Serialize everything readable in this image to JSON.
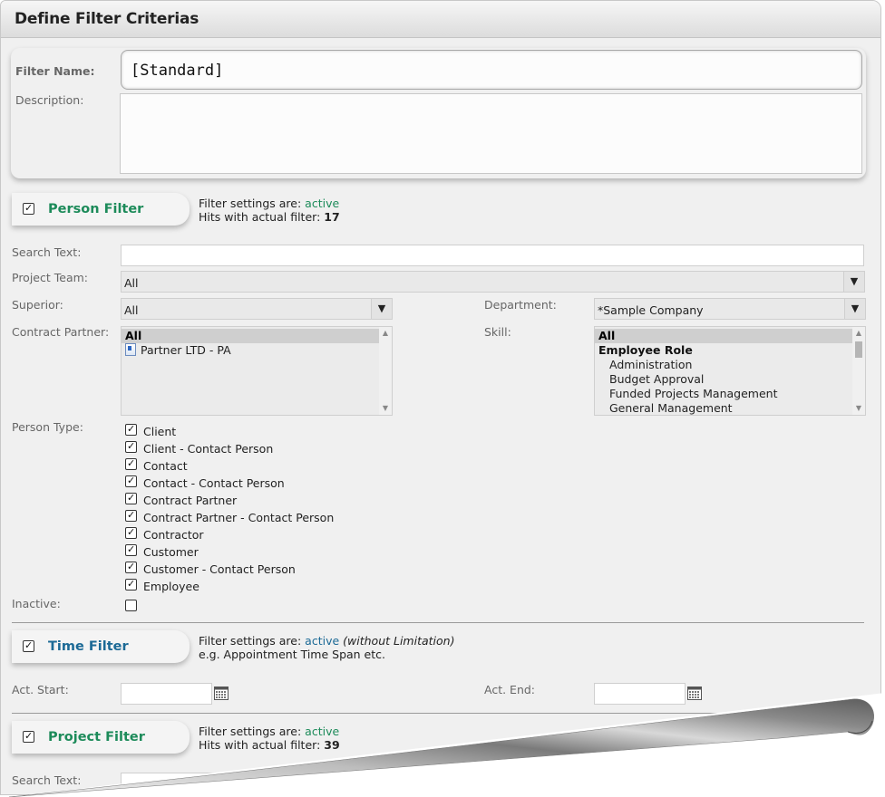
{
  "window": {
    "title": "Define Filter Criterias"
  },
  "filter": {
    "name_label": "Filter Name:",
    "name_value": "[Standard]",
    "description_label": "Description:",
    "description_value": ""
  },
  "person_filter": {
    "tab_label": "Person Filter",
    "checked": true,
    "status_prefix": "Filter settings are:",
    "status": "active",
    "hits_label": "Hits with actual filter:",
    "hits": "17",
    "search_label": "Search Text:",
    "search_value": "",
    "project_team_label": "Project Team:",
    "project_team_value": "All",
    "superior_label": "Superior:",
    "superior_value": "All",
    "department_label": "Department:",
    "department_value": "*Sample Company",
    "contract_partner_label": "Contract Partner:",
    "contract_partner_items": [
      "All",
      "Partner LTD - PA"
    ],
    "skill_label": "Skill:",
    "skill_items": [
      "All",
      "Employee Role",
      "Administration",
      "Budget Approval",
      "Funded Projects Management",
      "General Management"
    ],
    "person_type_label": "Person Type:",
    "person_types": [
      {
        "label": "Client",
        "checked": true
      },
      {
        "label": "Client - Contact Person",
        "checked": true
      },
      {
        "label": "Contact",
        "checked": true
      },
      {
        "label": "Contact - Contact Person",
        "checked": true
      },
      {
        "label": "Contract Partner",
        "checked": true
      },
      {
        "label": "Contract Partner - Contact Person",
        "checked": true
      },
      {
        "label": "Contractor",
        "checked": true
      },
      {
        "label": "Customer",
        "checked": true
      },
      {
        "label": "Customer - Contact Person",
        "checked": true
      },
      {
        "label": "Employee",
        "checked": true
      }
    ],
    "inactive_label": "Inactive:",
    "inactive_checked": false
  },
  "time_filter": {
    "tab_label": "Time Filter",
    "checked": true,
    "status_prefix": "Filter settings are:",
    "status": "active",
    "status_note": "(without Limitation)",
    "example": "e.g. Appointment Time Span etc.",
    "start_label": "Act. Start:",
    "start_value": "",
    "end_label": "Act. End:",
    "end_value": ""
  },
  "project_filter": {
    "tab_label": "Project Filter",
    "checked": true,
    "status_prefix": "Filter settings are:",
    "status": "active",
    "hits_label": "Hits with actual filter:",
    "hits": "39",
    "search_label": "Search Text:"
  },
  "colors": {
    "active_green": "#1d8b5a",
    "time_blue": "#1c6a96",
    "panel_bg": "#f0f0f0"
  },
  "icons": {
    "checkbox": "check-icon",
    "dropdown": "chevron-down-icon",
    "calendar": "calendar-icon",
    "partner": "document-icon"
  }
}
